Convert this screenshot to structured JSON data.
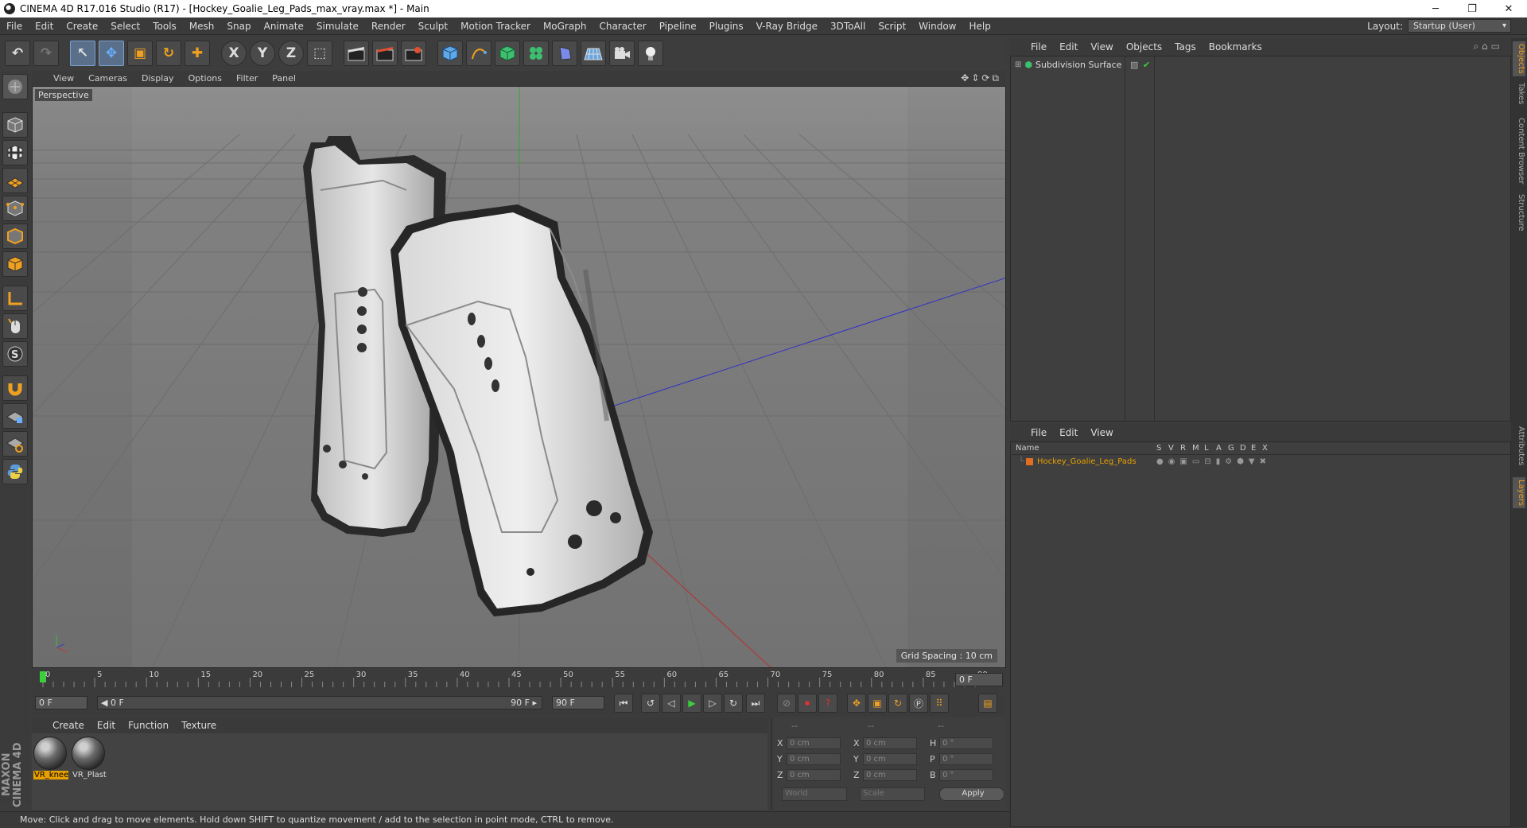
{
  "window": {
    "title": "CINEMA 4D R17.016 Studio (R17) - [Hockey_Goalie_Leg_Pads_max_vray.max *] - Main",
    "minimize": "─",
    "maximize": "❐",
    "close": "✕"
  },
  "menubar": {
    "items": [
      "File",
      "Edit",
      "Create",
      "Select",
      "Tools",
      "Mesh",
      "Snap",
      "Animate",
      "Simulate",
      "Render",
      "Sculpt",
      "Motion Tracker",
      "MoGraph",
      "Character",
      "Pipeline",
      "Plugins",
      "V-Ray Bridge",
      "3DToAll",
      "Script",
      "Window",
      "Help"
    ],
    "layout_label": "Layout:",
    "layout_value": "Startup (User)"
  },
  "toolbar": {
    "undo": "↶",
    "redo": "↷",
    "select": "↖",
    "move": "✥",
    "scale": "▣",
    "rotate": "↻",
    "add": "✚",
    "x_axis": "X",
    "y_axis": "Y",
    "z_axis": "Z",
    "coord": "⬚"
  },
  "viewport": {
    "menu": [
      "View",
      "Cameras",
      "Display",
      "Options",
      "Filter",
      "Panel"
    ],
    "camera_label": "Perspective",
    "grid_spacing": "Grid Spacing : 10 cm",
    "nav_icons": "✥⇕⟳⧉"
  },
  "timeline": {
    "ticks": [
      "0",
      "5",
      "10",
      "15",
      "20",
      "25",
      "30",
      "35",
      "40",
      "45",
      "50",
      "55",
      "60",
      "65",
      "70",
      "75",
      "80",
      "85",
      "90"
    ],
    "current_frame": "0 F",
    "start_field": "0 F",
    "range_start": "◀ 0 F",
    "range_end": "90 F ▸",
    "end_field": "90 F"
  },
  "materials": {
    "menu": [
      "Create",
      "Edit",
      "Function",
      "Texture"
    ],
    "items": [
      {
        "label": "VR_knee",
        "selected": true
      },
      {
        "label": "VR_Plast",
        "selected": false
      }
    ]
  },
  "coords": {
    "headers": [
      "--",
      "--",
      "--"
    ],
    "rows": [
      {
        "a": "X",
        "av": "0 cm",
        "b": "X",
        "bv": "0 cm",
        "c": "H",
        "cv": "0 °"
      },
      {
        "a": "Y",
        "av": "0 cm",
        "b": "Y",
        "bv": "0 cm",
        "c": "P",
        "cv": "0 °"
      },
      {
        "a": "Z",
        "av": "0 cm",
        "b": "Z",
        "bv": "0 cm",
        "c": "B",
        "cv": "0 °"
      }
    ],
    "mode1": "World",
    "mode2": "Scale",
    "apply": "Apply"
  },
  "objects": {
    "menu": [
      "File",
      "Edit",
      "View",
      "Objects",
      "Tags",
      "Bookmarks"
    ],
    "items": [
      {
        "name": "Subdivision Surface"
      }
    ]
  },
  "layers": {
    "menu": [
      "File",
      "Edit",
      "View"
    ],
    "columns": [
      "Name",
      "S",
      "V",
      "R",
      "M",
      "L",
      "A",
      "G",
      "D",
      "E",
      "X"
    ],
    "items": [
      {
        "name": "Hockey_Goalie_Leg_Pads",
        "color": "#e07020"
      }
    ]
  },
  "side_tabs": [
    "Objects",
    "Takes",
    "Content Browser",
    "Structure",
    "Attributes",
    "Layers"
  ],
  "status": "Move: Click and drag to move elements. Hold down SHIFT to quantize movement / add to the selection in point mode, CTRL to remove.",
  "logo": {
    "text": "MAXON CINEMA 4D"
  },
  "colors": {
    "accent": "#e8a000",
    "active_tool": "#5a6f8a",
    "play": "#3ccf3c"
  }
}
